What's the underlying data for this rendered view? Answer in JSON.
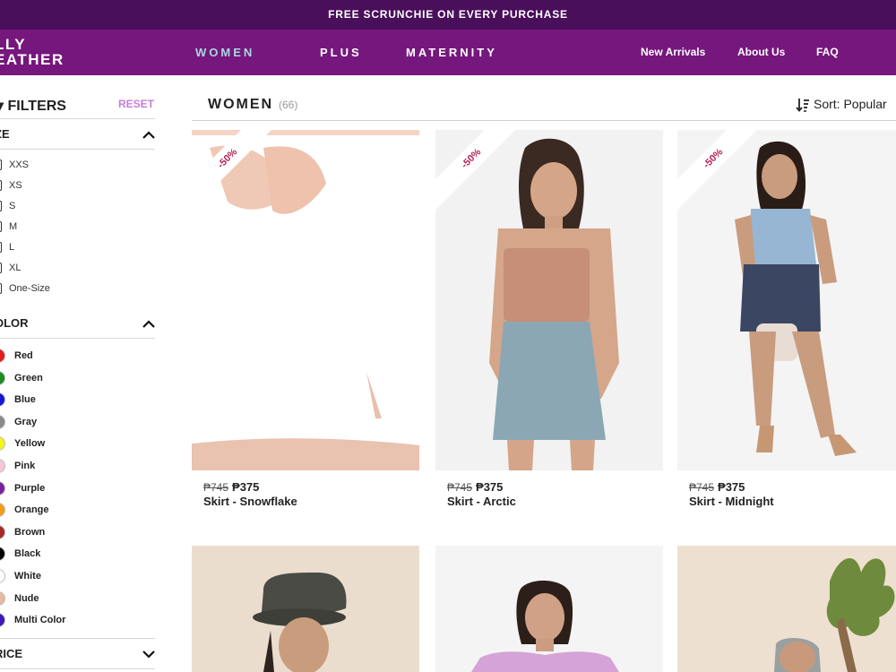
{
  "promo": {
    "text": "FREE SCRUNCHIE ON EVERY PURCHASE"
  },
  "header": {
    "logo_line1": "LLY",
    "logo_line2": "EATHER",
    "nav": [
      "WOMEN",
      "PLUS",
      "MATERNITY"
    ],
    "links": [
      "New Arrivals",
      "About Us",
      "FAQ"
    ],
    "colors": {
      "promo_bg": "#4a0f5b",
      "header_bg": "#76177d",
      "active_nav": "#a8d7e0"
    }
  },
  "sidebar": {
    "title": "FILTERS",
    "reset_label": "RESET",
    "size_section": {
      "title": "ZE",
      "expanded": true,
      "items": [
        "XXS",
        "XS",
        "S",
        "M",
        "L",
        "XL",
        "One-Size"
      ]
    },
    "color_section": {
      "title": "OLOR",
      "expanded": true,
      "items": [
        {
          "label": "Red",
          "color": "#e31c1c"
        },
        {
          "label": "Green",
          "color": "#1e8c1e"
        },
        {
          "label": "Blue",
          "color": "#1515d6"
        },
        {
          "label": "Gray",
          "color": "#8a8a8a"
        },
        {
          "label": "Yellow",
          "color": "#f5f51a"
        },
        {
          "label": "Pink",
          "color": "#f7c6d4"
        },
        {
          "label": "Purple",
          "color": "#7b1fa2"
        },
        {
          "label": "Orange",
          "color": "#f59a12"
        },
        {
          "label": "Brown",
          "color": "#a52a2a"
        },
        {
          "label": "Black",
          "color": "#000000"
        },
        {
          "label": "White",
          "color": "#ffffff"
        },
        {
          "label": "Nude",
          "color": "#e8b8a0"
        },
        {
          "label": "Multi Color",
          "color": "#3d1ab8"
        }
      ]
    },
    "price_section": {
      "title": "RICE",
      "expanded": false
    }
  },
  "main": {
    "title": "WOMEN",
    "count": "(66)",
    "sort_label": "Sort: Popular"
  },
  "products": [
    {
      "badge": "-50%",
      "price_old": "₱745",
      "price_new": "₱375",
      "name": "Skirt - Snowflake"
    },
    {
      "badge": "-50%",
      "price_old": "₱745",
      "price_new": "₱375",
      "name": "Skirt - Arctic"
    },
    {
      "badge": "-50%",
      "price_old": "₱745",
      "price_new": "₱375",
      "name": "Skirt - Midnight"
    },
    {
      "badge": "",
      "price_old": "",
      "price_new": "",
      "name": ""
    },
    {
      "badge": "",
      "price_old": "",
      "price_new": "",
      "name": ""
    },
    {
      "badge": "",
      "price_old": "",
      "price_new": "",
      "name": ""
    }
  ]
}
